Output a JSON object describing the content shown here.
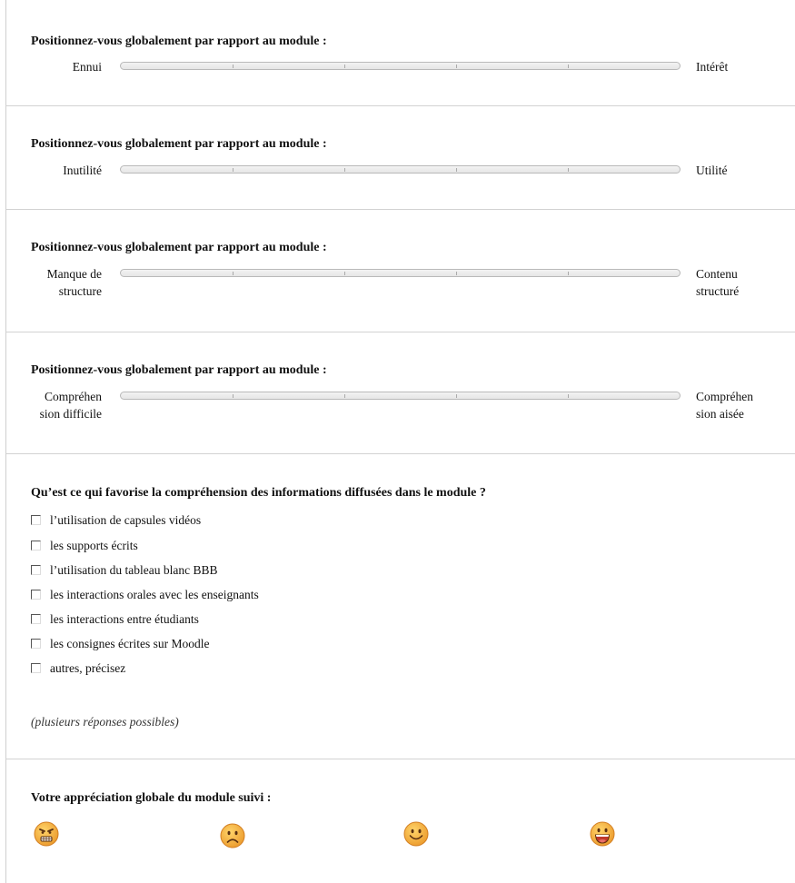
{
  "scales": [
    {
      "question": "Positionnez-vous globalement par rapport au module :",
      "left": [
        "Ennui"
      ],
      "right": [
        "Intérêt"
      ]
    },
    {
      "question": "Positionnez-vous globalement par rapport au module :",
      "left": [
        "Inutilité"
      ],
      "right": [
        "Utilité"
      ]
    },
    {
      "question": "Positionnez-vous globalement par rapport au module :",
      "left": [
        "Manque de",
        "structure"
      ],
      "right": [
        "Contenu",
        "structuré"
      ]
    },
    {
      "question": "Positionnez-vous globalement par rapport au module :",
      "left": [
        "Compréhen",
        "sion difficile"
      ],
      "right": [
        "Compréhen",
        "sion aisée"
      ]
    }
  ],
  "checklist": {
    "question": "Qu’est ce qui favorise la compréhension des informations diffusées dans le module ?",
    "options": [
      "l’utilisation de capsules vidéos",
      "les supports écrits",
      "l’utilisation du tableau blanc BBB",
      "les interactions orales avec les enseignants",
      "les interactions entre étudiants",
      "les consignes écrites sur Moodle",
      "autres, précisez"
    ],
    "note": "(plusieurs réponses possibles)"
  },
  "appreciation": {
    "question": "Votre appréciation globale du module suivi :",
    "options": [
      "angry-face-icon",
      "sad-face-icon",
      "smiling-face-icon",
      "laughing-face-icon"
    ]
  },
  "colors": {
    "smiley_fill": "#f5b43c",
    "smiley_edge": "#d9822b"
  }
}
